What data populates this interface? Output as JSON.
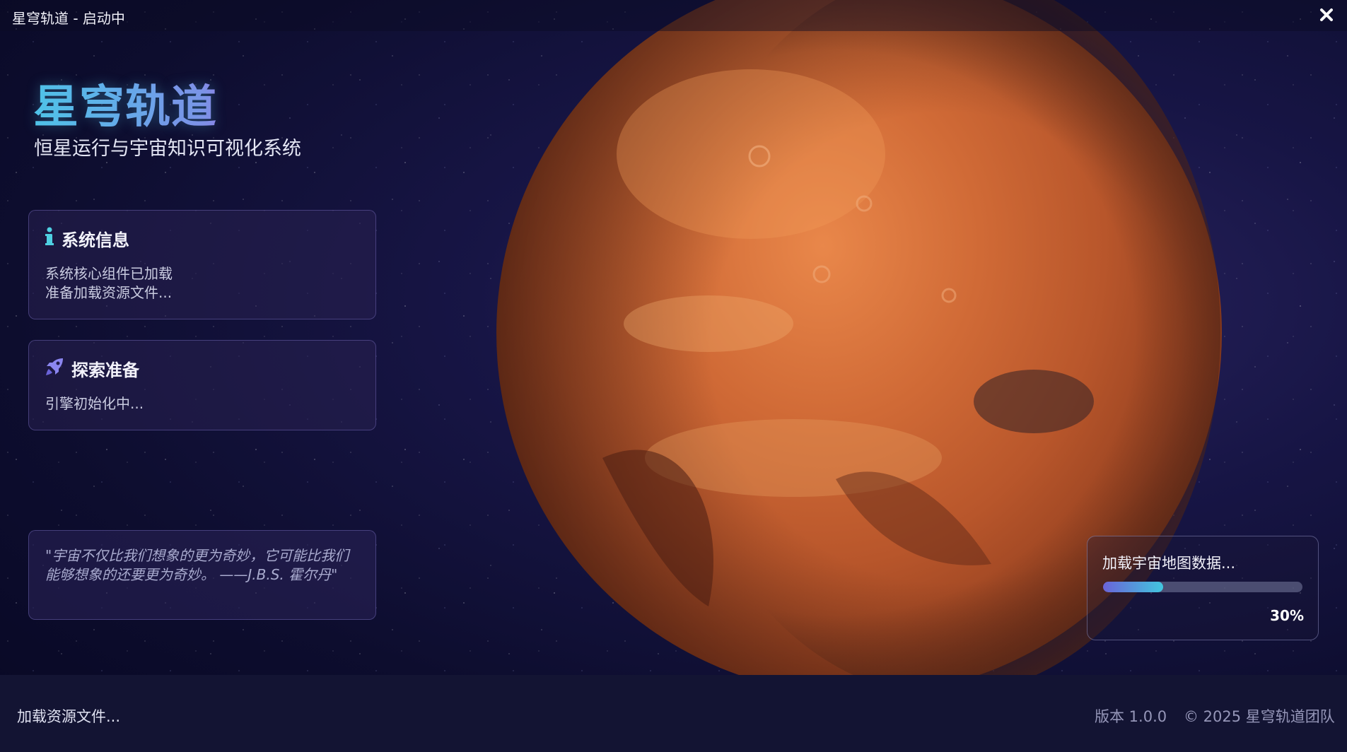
{
  "window": {
    "title": "星穹轨道 - 启动中",
    "close_icon": "close-icon"
  },
  "brand": {
    "title": "星穹轨道",
    "subtitle": "恒星运行与宇宙知识可视化系统"
  },
  "cards": {
    "system_info": {
      "icon": "info-icon",
      "title": "系统信息",
      "lines": [
        "系统核心组件已加载",
        "准备加载资源文件..."
      ]
    },
    "explore": {
      "icon": "rocket-icon",
      "title": "探索准备",
      "lines": [
        "引擎初始化中..."
      ]
    },
    "quote": {
      "text": "\"宇宙不仅比我们想象的更为奇妙，它可能比我们能够想象的还要更为奇妙。 ——J.B.S. 霍尔丹\""
    }
  },
  "loader": {
    "label": "加载宇宙地图数据...",
    "progress": 30,
    "progress_label": "30%"
  },
  "footer": {
    "status": "加载资源文件...",
    "version": "版本 1.0.0",
    "copyright": "© 2025 星穹轨道团队"
  },
  "colors": {
    "accent_cyan": "#42c6de",
    "accent_purple": "#6a63d8",
    "background": "#0d0d2e",
    "footer_bg": "#131433"
  }
}
